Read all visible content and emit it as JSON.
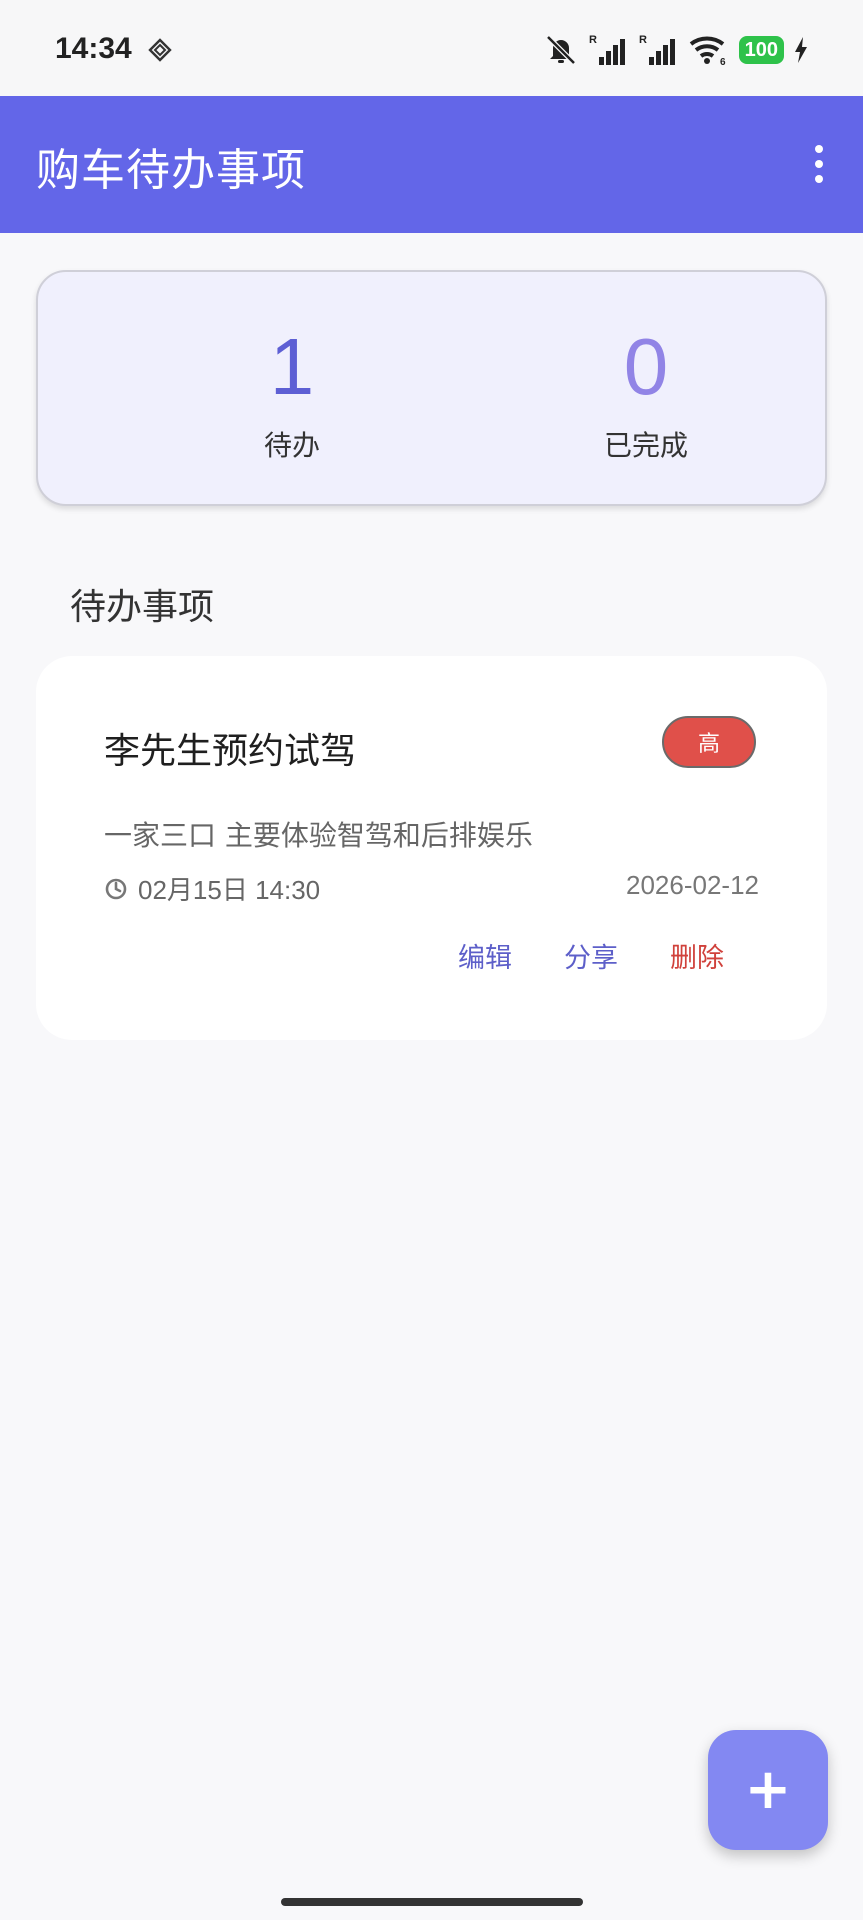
{
  "status_bar": {
    "time": "14:34",
    "battery": "100",
    "icons": [
      "diamond-icon",
      "mute-icon",
      "signal-r-icon",
      "signal-r-icon",
      "wifi-6-icon",
      "battery-icon",
      "charging-icon"
    ]
  },
  "app_bar": {
    "title": "购车待办事项",
    "menu_icon": "more-vert-icon"
  },
  "stats": {
    "pending_count": "1",
    "pending_label": "待办",
    "done_count": "0",
    "done_label": "已完成"
  },
  "section": {
    "title": "待办事项"
  },
  "todos": [
    {
      "title": "李先生预约试驾",
      "priority": "高",
      "description": "一家三口 主要体验智驾和后排娱乐",
      "time": "02月15日 14:30",
      "date": "2026-02-12",
      "actions": {
        "edit": "编辑",
        "share": "分享",
        "delete": "删除"
      }
    }
  ],
  "fab": {
    "icon": "plus-icon",
    "label": "+"
  },
  "colors": {
    "primary": "#6366e8",
    "stats_bg": "#f0f0fd",
    "priority_high": "#e0504a",
    "fab": "#8388f2",
    "delete": "#d0413b"
  }
}
